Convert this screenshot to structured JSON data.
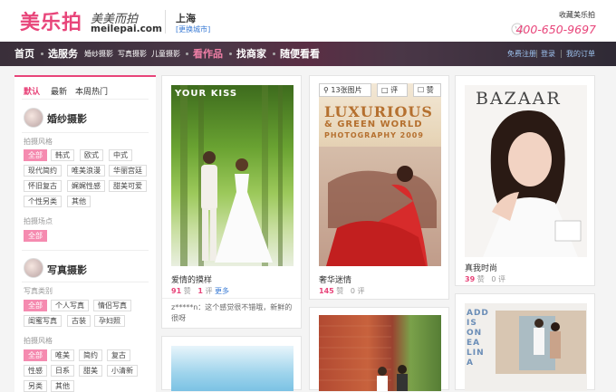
{
  "header": {
    "logo_cn": "美乐拍",
    "logo_script": "美美而拍",
    "logo_domain": "meilepai.com",
    "city": "上海",
    "city_change": "[更换城市]",
    "favorite": "收藏美乐拍",
    "phone": "400-650-9697",
    "phone_icon": "phone-icon"
  },
  "nav": {
    "items": [
      {
        "label": "首页"
      },
      {
        "label": "选服务"
      },
      {
        "label": "婚纱摄影"
      },
      {
        "label": "写真摄影"
      },
      {
        "label": "儿童摄影"
      },
      {
        "label": "看作品"
      },
      {
        "label": "找商家"
      },
      {
        "label": "随便看看"
      }
    ],
    "right": [
      "免费注册",
      "登录",
      "我的订单"
    ]
  },
  "sidebar": {
    "tabs": [
      "默认",
      "最新",
      "本周热门"
    ],
    "sections": [
      {
        "title": "婚纱摄影",
        "groups": [
          {
            "label": "拍摄风格",
            "tags": [
              "全部",
              "韩式",
              "欧式",
              "中式",
              "现代简约",
              "唯美浪漫",
              "华丽宫廷",
              "怀旧复古",
              "娓娓性感",
              "甜美可爱",
              "个性另类",
              "其他"
            ]
          },
          {
            "label": "拍摄场点",
            "tags": [
              "全部"
            ]
          }
        ]
      },
      {
        "title": "写真摄影",
        "groups": [
          {
            "label": "写真类别",
            "tags": [
              "全部",
              "个人写真",
              "情侣写真",
              "闺蜜写真",
              "古装",
              "孕妇照"
            ]
          },
          {
            "label": "拍摄风格",
            "tags": [
              "全部",
              "唯美",
              "简约",
              "复古",
              "性感",
              "日系",
              "甜美",
              "小清新",
              "另类",
              "其他"
            ]
          }
        ]
      }
    ]
  },
  "cards": [
    {
      "photo_caption": "YOUR KISS",
      "title": "爱情的摸样",
      "likes": "91",
      "likes_unit": "赞",
      "comments": "1",
      "comments_unit": "评",
      "more": "更多",
      "comment_text": "z*****n：这个感觉很不错哦，新鲜的很呀"
    },
    {
      "overlay_count": "13张图片",
      "overlay_comment": "评",
      "overlay_like": "赞",
      "photo_caption_1": "LUXURIOUS",
      "photo_caption_2": "& GREEN WORLD",
      "photo_caption_3": "PHOTOGRAPHY 2009",
      "title": "奢华迷情",
      "likes": "145",
      "likes_unit": "赞",
      "comments": "0",
      "comments_unit": "评"
    },
    {
      "photo_caption": "BAZAAR",
      "title": "真我时尚",
      "likes": "39",
      "likes_unit": "赞",
      "comments": "0",
      "comments_unit": "评"
    },
    {
      "photo_caption": "ADD IS ON EA LIN A"
    }
  ]
}
